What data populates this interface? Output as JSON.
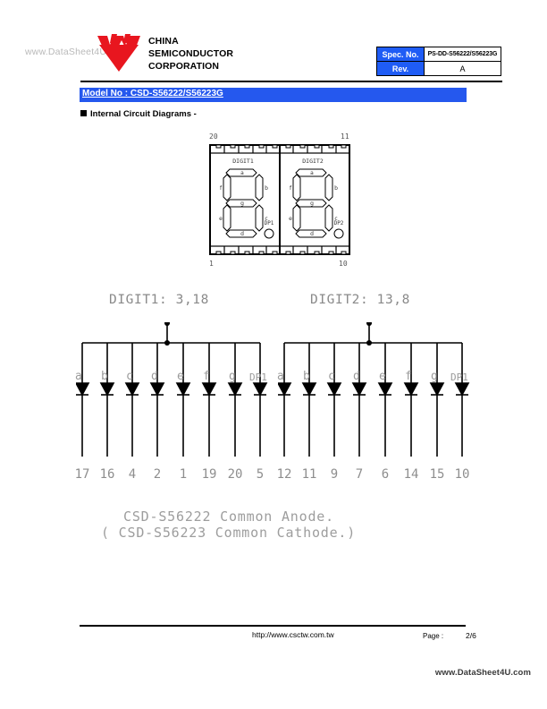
{
  "watermarks": {
    "top": "www.DataSheet4U.com",
    "bottom": "www.DataSheet4U.com"
  },
  "header": {
    "logo_icon": "company-chevron-logo-icon",
    "company_line1": "CHINA",
    "company_line2": "SEMICONDUCTOR",
    "company_line3": "CORPORATION",
    "spec_table": {
      "spec_no_label": "Spec. No.",
      "spec_no_value": "PS-DD-S56222/S56223G",
      "rev_label": "Rev.",
      "rev_value": "A"
    }
  },
  "model_banner": {
    "text": "Model No : CSD-S56222/S56223G",
    "background": "#2558ee"
  },
  "section": {
    "title": "Internal Circuit Diagrams -",
    "bullet_icon": "black-square-bullet-icon"
  },
  "package": {
    "pins": {
      "top_left": "20",
      "top_right": "11",
      "bottom_left": "1",
      "bottom_right": "10"
    },
    "digits": [
      {
        "name": "DIGIT1",
        "segments": [
          "a",
          "b",
          "c",
          "d",
          "e",
          "f",
          "g"
        ],
        "decimal_point": "DP1"
      },
      {
        "name": "DIGIT2",
        "segments": [
          "a",
          "b",
          "c",
          "d",
          "e",
          "f",
          "g"
        ],
        "decimal_point": "DP2"
      }
    ]
  },
  "circuits": [
    {
      "id": "digit1",
      "common_label": "DIGIT1: 3,18",
      "segment_labels": [
        "a",
        "b",
        "c",
        "d",
        "e",
        "f",
        "g",
        "DP1"
      ],
      "pin_numbers": [
        "17",
        "16",
        "4",
        "2",
        "1",
        "19",
        "20",
        "5"
      ]
    },
    {
      "id": "digit2",
      "common_label": "DIGIT2: 13,8",
      "segment_labels": [
        "a",
        "b",
        "c",
        "d",
        "e",
        "f",
        "g",
        "DP1"
      ],
      "pin_numbers": [
        "12",
        "11",
        "9",
        "7",
        "6",
        "14",
        "15",
        "10"
      ]
    }
  ],
  "caption": {
    "line1": "CSD-S56222 Common Anode.",
    "line2": "( CSD-S56223 Common Cathode.)"
  },
  "footer": {
    "url": "http://www.csctw.com.tw",
    "page_label": "Page :",
    "page_value": "2/6"
  }
}
